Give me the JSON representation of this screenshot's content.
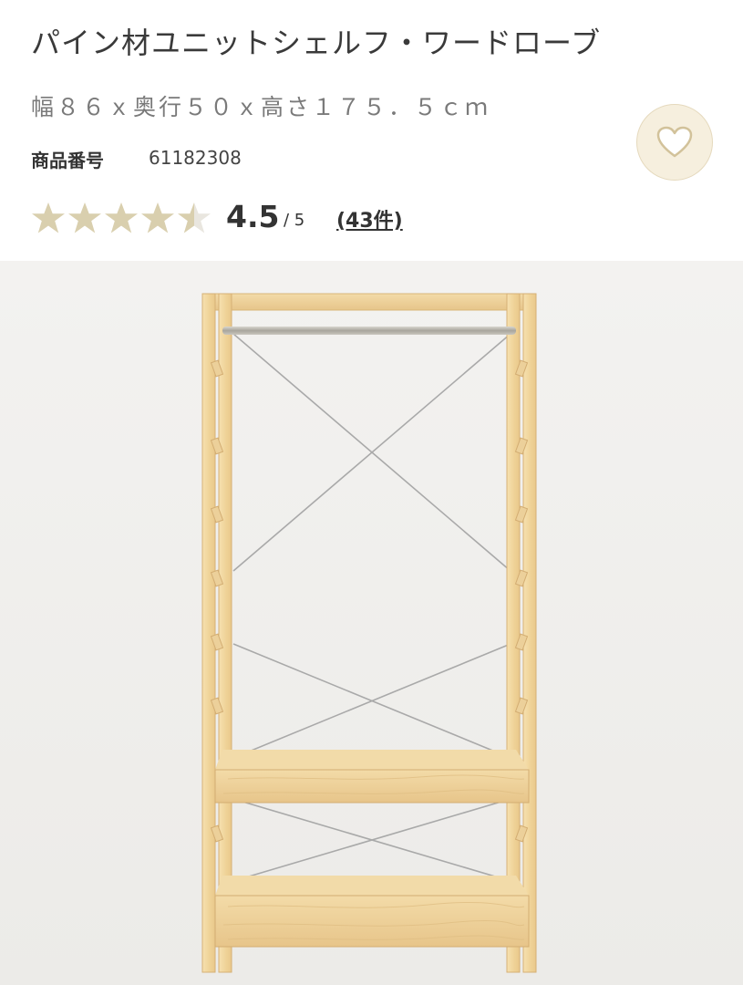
{
  "product": {
    "title": "パイン材ユニットシェルフ・ワードローブ",
    "dimensions": "幅８６ｘ奥行５０ｘ高さ１７５．５ｃｍ",
    "number_label": "商品番号",
    "number_value": "61182308"
  },
  "rating": {
    "stars": 4.5,
    "value": "4.5",
    "max": "/ 5",
    "review_count": "(43件)"
  },
  "icons": {
    "favorite": "heart-icon",
    "star": "star-icon"
  },
  "colors": {
    "star_filled": "#d9cfae",
    "star_empty": "#e9e6df",
    "favorite_bg": "#f6efde",
    "wood": "#f1d9a4"
  },
  "image": {
    "subject": "product-photo"
  }
}
